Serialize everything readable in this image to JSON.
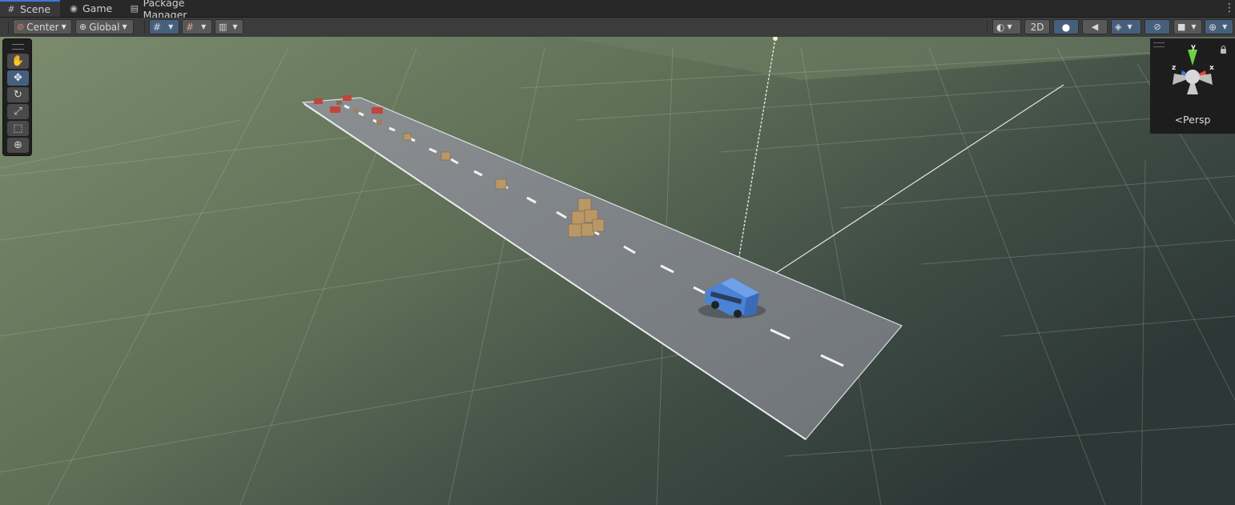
{
  "tabs": [
    {
      "label": "Scene",
      "icon": "grid-icon"
    },
    {
      "label": "Game",
      "icon": "gamepad-icon"
    },
    {
      "label": "Package Manager",
      "icon": "package-icon"
    }
  ],
  "toolbar": {
    "pivot_mode": "Center",
    "pivot_rotation": "Global",
    "mode_2d": "2D"
  },
  "tools": [
    "hand-tool",
    "move-tool",
    "rotate-tool",
    "scale-tool",
    "rect-tool",
    "transform-tool"
  ],
  "gizmo": {
    "projection": "Persp",
    "axis_y": "y",
    "axis_x": "x",
    "axis_z": "z"
  },
  "colors": {
    "accent": "#3a79d8",
    "active_button": "#46607c",
    "car_blue": "#4b82d4",
    "ground_top": "#7a8a6c",
    "ground_right": "#2f3a37"
  }
}
